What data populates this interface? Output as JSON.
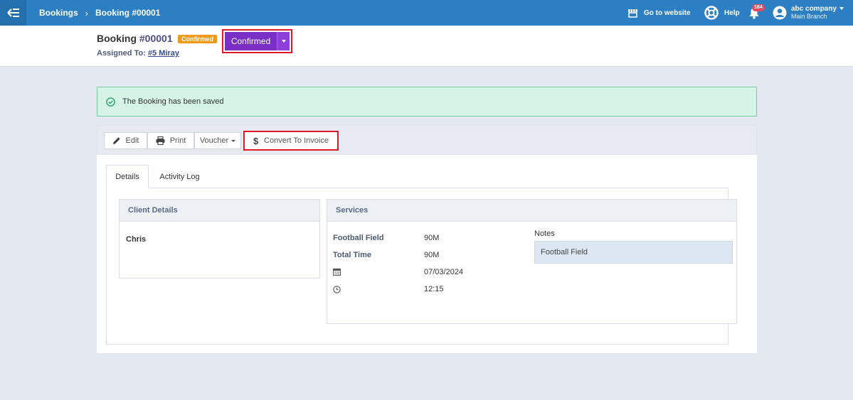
{
  "topbar": {
    "breadcrumb": [
      "Bookings",
      "Booking #00001"
    ],
    "breadcrumb_sep": "›",
    "go_to_website": "Go to website",
    "help": "Help",
    "notifications_count": "184",
    "user_company": "abc company",
    "user_branch": "Main Branch"
  },
  "header": {
    "title": "Booking",
    "number": "#00001",
    "status_badge": "Confirmed",
    "assigned_label": "Assigned To:",
    "assigned_value": "#5 Miray",
    "status_select": "Confirmed"
  },
  "alert": {
    "message": "The Booking has been saved"
  },
  "actions": {
    "edit": "Edit",
    "print": "Print",
    "voucher": "Voucher",
    "convert": "Convert To Invoice"
  },
  "tabs": [
    {
      "label": "Details",
      "active": true
    },
    {
      "label": "Activity Log",
      "active": false
    }
  ],
  "client": {
    "heading": "Client Details",
    "name": "Chris"
  },
  "services": {
    "heading": "Services",
    "rows": [
      {
        "label": "Football Field",
        "value": "90M"
      },
      {
        "label": "Total Time",
        "value": "90M"
      },
      {
        "icon": "calendar-icon",
        "value": "07/03/2024"
      },
      {
        "icon": "clock-icon",
        "value": "12:15"
      }
    ],
    "notes_label": "Notes",
    "notes_value": "Football Field"
  },
  "colors": {
    "topbar": "#2b7fc2",
    "status_purple": "#7a2fc7",
    "badge_orange": "#f39a1a",
    "alert_green": "#d6f3e7",
    "highlight_red": "#e0192a"
  }
}
